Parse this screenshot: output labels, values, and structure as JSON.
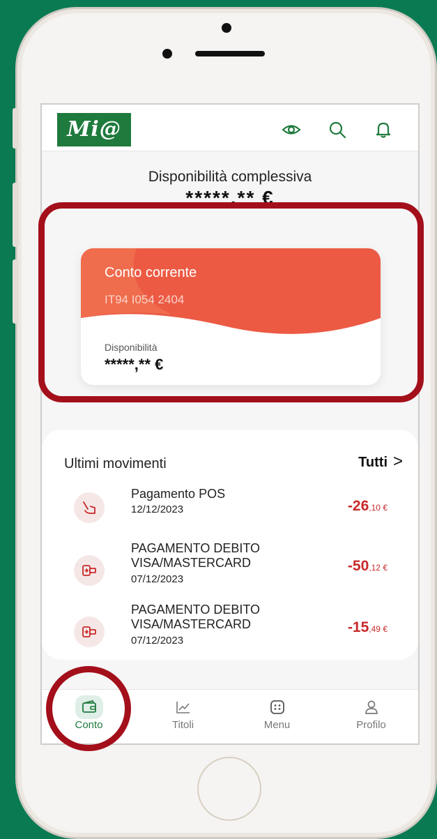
{
  "colors": {
    "background": "#0a7a52",
    "brand_green": "#1f7a3d",
    "card_orange": "#ec5a44",
    "debit_red": "#c92a2a",
    "highlight": "#a30f1a"
  },
  "header": {
    "logo_text": "Mi@",
    "icons": [
      "eye-icon",
      "search-icon",
      "bell-icon"
    ]
  },
  "balance": {
    "title": "Disponibilità complessiva",
    "amount": "*****,** €"
  },
  "account_card": {
    "title": "Conto corrente",
    "iban": "IT94 I054 2404",
    "available_label": "Disponibilità",
    "available_value": "*****,** €"
  },
  "movements": {
    "title": "Ultimi movimenti",
    "all_label": "Tutti",
    "all_chevron": ">",
    "items": [
      {
        "icon": "pos-payment-icon",
        "description": "Pagamento POS",
        "date": "12/12/2023",
        "amount_int": "-26",
        "amount_cents": ",10 €"
      },
      {
        "icon": "card-payment-icon",
        "description": "PAGAMENTO DEBITO VISA/MASTERCARD",
        "date": "07/12/2023",
        "amount_int": "-50",
        "amount_cents": ",12 €"
      },
      {
        "icon": "card-payment-icon",
        "description": "PAGAMENTO DEBITO VISA/MASTERCARD",
        "date": "07/12/2023",
        "amount_int": "-15",
        "amount_cents": ",49 €"
      }
    ]
  },
  "bottom_nav": {
    "items": [
      {
        "label": "Conto",
        "icon": "wallet-icon",
        "active": true
      },
      {
        "label": "Titoli",
        "icon": "chart-icon",
        "active": false
      },
      {
        "label": "Menu",
        "icon": "menu-icon",
        "active": false
      },
      {
        "label": "Profilo",
        "icon": "profile-icon",
        "active": false
      }
    ]
  }
}
